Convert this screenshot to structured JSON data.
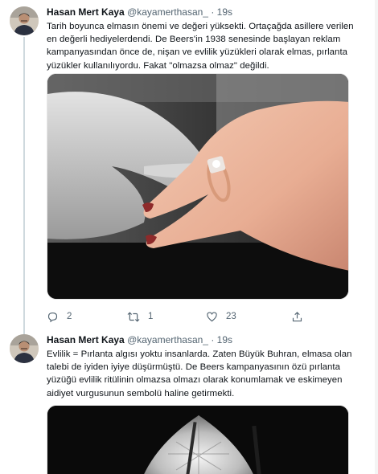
{
  "tweets": [
    {
      "author": {
        "name": "Hasan Mert Kaya",
        "handle": "@kayamerthasan_",
        "separator": "·",
        "time": "19s"
      },
      "text": "Tarih boyunca elmasın önemi ve değeri yüksekti. Ortaçağda asillere verilen\nen değerli hediyelerdendi. De Beers'in 1938 senesinde başlayan reklam\nkampanyasından önce de, nişan ve evlilik yüzükleri olarak elmas, pırlanta\nyüzükler kullanılıyordu. Fakat \"olmazsa olmaz\" değildi.",
      "media": {
        "description_icon": "ring-photo"
      },
      "actions": {
        "reply_count": "2",
        "retweet_count": "1",
        "like_count": "23"
      }
    },
    {
      "author": {
        "name": "Hasan Mert Kaya",
        "handle": "@kayamerthasan_",
        "separator": "·",
        "time": "19s"
      },
      "text": "Evlilik = Pırlanta algısı yoktu insanlarda. Zaten Büyük Buhran, elmasa olan\ntalebi de iyiden iyiye düşürmüştü. De Beers kampanyasının özü pırlanta\nyüzüğü evlilik ritülinin olmazsa olmazı olarak konumlamak ve eskimeyen\naidiyet vurgusunun sembolü haline getirmekti.",
      "media": {
        "description_icon": "diamond-photo"
      }
    }
  ],
  "colors": {
    "text": "#0f1419",
    "secondary": "#536471",
    "thread_line": "#cfd9de",
    "divider": "#eff3f4"
  }
}
